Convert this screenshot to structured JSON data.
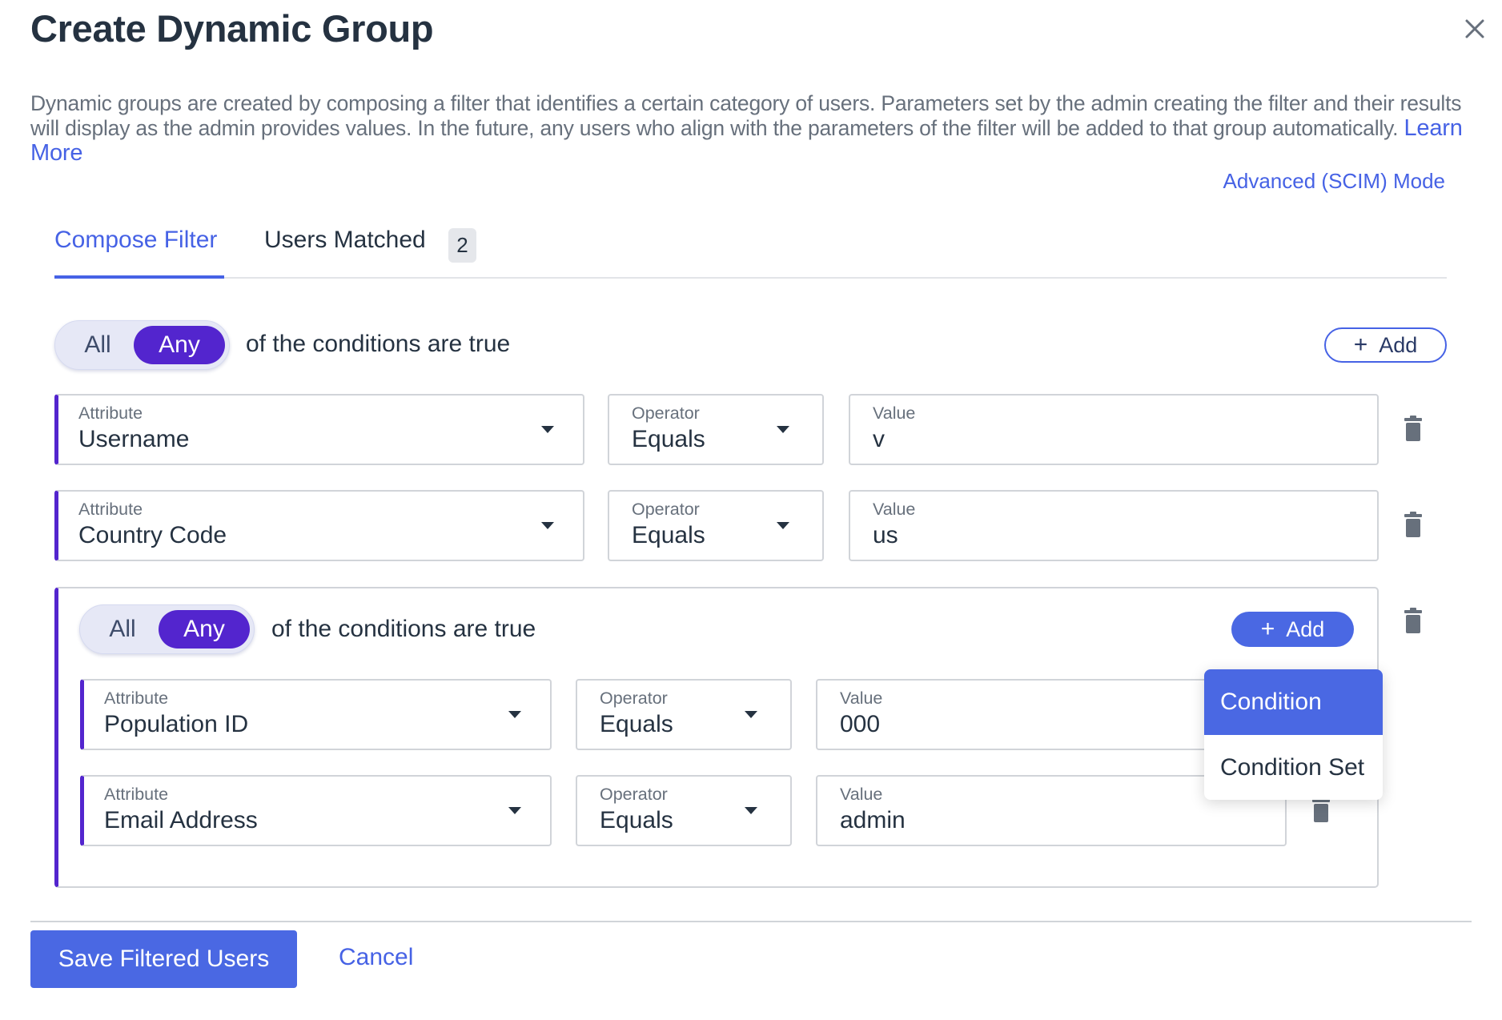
{
  "dialog": {
    "title": "Create Dynamic Group",
    "close_icon": "close-icon",
    "description": "Dynamic groups are created by composing a filter that identifies a certain category of users. Parameters set by the admin creating the filter and their results will display as the admin provides values. In the future, any users who align with the parameters of the filter will be added to that group automatically.",
    "learn_more": "Learn More",
    "advanced_mode": "Advanced (SCIM) Mode"
  },
  "tabs": [
    {
      "label": "Compose Filter",
      "active": true
    },
    {
      "label": "Users Matched",
      "badge": "2",
      "active": false
    }
  ],
  "filter": {
    "toggle": {
      "all": "All",
      "any": "Any",
      "selected": "Any"
    },
    "conditions_text": "of the conditions are true",
    "add_label": "Add",
    "add_icon": "plus-icon",
    "rows": [
      {
        "attribute_label": "Attribute",
        "attribute": "Username",
        "operator_label": "Operator",
        "operator": "Equals",
        "value_label": "Value",
        "value": "v"
      },
      {
        "attribute_label": "Attribute",
        "attribute": "Country Code",
        "operator_label": "Operator",
        "operator": "Equals",
        "value_label": "Value",
        "value": "us"
      }
    ],
    "group": {
      "toggle": {
        "all": "All",
        "any": "Any",
        "selected": "Any"
      },
      "conditions_text": "of the conditions are true",
      "add_label": "Add",
      "rows": [
        {
          "attribute_label": "Attribute",
          "attribute": "Population ID",
          "operator_label": "Operator",
          "operator": "Equals",
          "value_label": "Value",
          "value": "000"
        },
        {
          "attribute_label": "Attribute",
          "attribute": "Email Address",
          "operator_label": "Operator",
          "operator": "Equals",
          "value_label": "Value",
          "value": "admin"
        }
      ]
    }
  },
  "add_menu": {
    "items": [
      {
        "label": "Condition",
        "highlighted": true
      },
      {
        "label": "Condition Set",
        "highlighted": false
      }
    ]
  },
  "footer": {
    "save_label": "Save Filtered Users",
    "cancel_label": "Cancel"
  },
  "colors": {
    "primary": "#4a68e3",
    "link": "#4662e5",
    "toggle_active": "#5325ce",
    "text": "#253241",
    "muted": "#67707c"
  }
}
